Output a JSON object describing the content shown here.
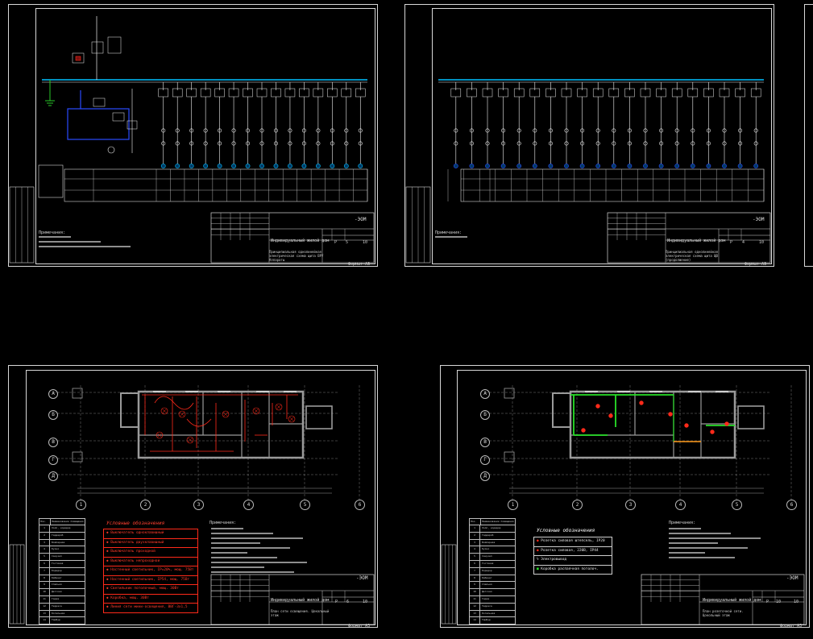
{
  "sheets": [
    {
      "id": "s1",
      "code": "-ЭОМ",
      "project": "Индивидуальный жилой дом",
      "title": "Принципиальная однолинейная электрическая схема щита ВРУ Аппараты",
      "stage": "Р",
      "page": "5",
      "total": "10",
      "format": "Формат А3",
      "notes_header": "Примечания:"
    },
    {
      "id": "s2",
      "code": "-ЭОМ",
      "project": "Индивидуальный жилой дом",
      "title": "Принципиальная однолинейная электрическая схема щита ЩО (продолжение)",
      "stage": "Р",
      "page": "4",
      "total": "10",
      "format": "Формат А3",
      "notes_header": "Примечания:"
    },
    {
      "id": "s3",
      "code": "-ЭОМ",
      "project": "Индивидуальный жилой дом",
      "title": "План сети освещения. Цокольный этаж",
      "stage": "Р",
      "page": "6",
      "total": "10",
      "format": "Формат А3",
      "legend_title": "Условные обозначения",
      "legend": [
        "Выключатель одноклавишный",
        "Выключатель двухклавишный",
        "Выключатель проходной",
        "Выключатель непроходной",
        "Настенный светильник, IP=20%, мощ. 75Вт",
        "Настенный светильник, IP54, мощ. 75Вт",
        "Светильник потолочный, мощ. 30Вт",
        "Коробка, мощ. 30Вт",
        "Линия сети мини-освещения, ВВГ-3х1,5"
      ],
      "notes_header": "Примечания:"
    },
    {
      "id": "s4",
      "code": "-ЭОМ",
      "project": "Индивидуальный жилой дом",
      "title": "План розеточной сети. Цокольный этаж",
      "stage": "Р",
      "page": "10",
      "total": "10",
      "format": "Формат А3",
      "legend_title": "Условные обозначения",
      "legend": [
        "Розетка силовая штепсель, IP20",
        "Розетка силовая, 220В, IP44",
        "Электровывод",
        "Коробка распаячная потолоч."
      ],
      "notes_header": "Примечания:"
    }
  ],
  "rooms": {
    "headers": [
      "Поз.",
      "Наименование помещения"
    ],
    "rows": [
      [
        "1",
        "Холл, коридор"
      ],
      [
        "2",
        "Гардероб"
      ],
      [
        "3",
        "Бойлерная"
      ],
      [
        "4",
        "Кухня"
      ],
      [
        "5",
        "Санузел"
      ],
      [
        "6",
        "Гостиная"
      ],
      [
        "7",
        "Коридор"
      ],
      [
        "8",
        "Кабинет"
      ],
      [
        "9",
        "Спальня"
      ],
      [
        "10",
        "Детская"
      ],
      [
        "11",
        "Гараж"
      ],
      [
        "12",
        "Терраса"
      ],
      [
        "13",
        "Котельная"
      ],
      [
        "14",
        "Тамбур"
      ]
    ]
  },
  "axes": {
    "vertical": [
      "1",
      "2",
      "3",
      "4",
      "5",
      "6"
    ],
    "horizontal": [
      "А",
      "Б",
      "В",
      "Г",
      "Д"
    ]
  },
  "colors": {
    "background": "#000000",
    "frame": "#d8d8d8",
    "bus": "#00c0ff",
    "line_white": "#f0f0f0",
    "lighting_red": "#ff2a1a",
    "socket_green": "#28e028",
    "blue_circuit": "#2a4bff",
    "grid_gray": "#9a9a9a",
    "earth_green": "#28c828"
  }
}
